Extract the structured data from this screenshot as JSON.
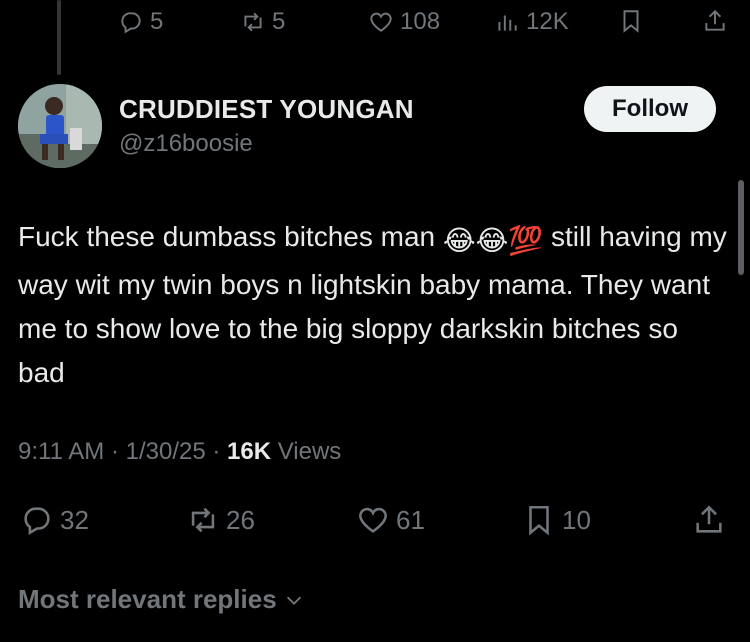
{
  "parent_actions": {
    "replies": "5",
    "reposts": "5",
    "likes": "108",
    "views": "12K"
  },
  "author": {
    "name": "CRUDDIEST YOUNGAN",
    "handle": "@z16boosie"
  },
  "follow_label": "Follow",
  "tweet": {
    "text_part1": "Fuck these dumbass bitches man ",
    "emojis": [
      "😂",
      "😂",
      "💯"
    ],
    "text_part2": " still having my way wit my twin boys n lightskin baby mama. They want me to show love to the big sloppy darkskin bitches so bad"
  },
  "meta": {
    "time": "9:11 AM",
    "date": "1/30/25",
    "views_count": "16K",
    "views_label": "Views"
  },
  "actions": {
    "replies": "32",
    "reposts": "26",
    "likes": "61",
    "bookmarks": "10"
  },
  "replies_sort": "Most relevant replies",
  "icons": [
    "reply-icon",
    "repost-icon",
    "like-icon",
    "views-icon",
    "bookmark-icon",
    "share-icon",
    "chevron-down-icon"
  ],
  "colors": {
    "background": "#000000",
    "text": "#e7e9ea",
    "secondary": "#71767b",
    "follow_bg": "#eff3f4"
  }
}
